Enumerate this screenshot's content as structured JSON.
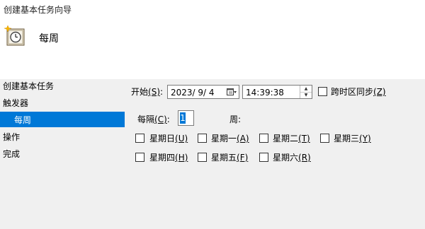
{
  "window": {
    "title": "创建基本任务向导"
  },
  "header": {
    "title": "每周",
    "icon": "task-clock-icon"
  },
  "steps": {
    "items": [
      {
        "label": "创建基本任务"
      },
      {
        "label": "触发器"
      },
      {
        "label": "每周",
        "active": true
      },
      {
        "label": "操作"
      },
      {
        "label": "完成"
      }
    ]
  },
  "form": {
    "start_label": "开始",
    "start_key": "(S)",
    "date_value": "2023/ 9/ 4",
    "time_value": "14:39:38",
    "sync_label": "跨时区同步",
    "sync_key": "(Z)",
    "sync_checked": false,
    "every_label": "每隔",
    "every_key": "(C)",
    "every_value": "1",
    "week_suffix": "周:",
    "days": [
      {
        "label": "星期日",
        "key": "(U)",
        "checked": false
      },
      {
        "label": "星期一",
        "key": "(A)",
        "checked": false
      },
      {
        "label": "星期二",
        "key": "(T)",
        "checked": false
      },
      {
        "label": "星期三",
        "key": "(Y)",
        "checked": false
      },
      {
        "label": "星期四",
        "key": "(H)",
        "checked": false
      },
      {
        "label": "星期五",
        "key": "(F)",
        "checked": false
      },
      {
        "label": "星期六",
        "key": "(R)",
        "checked": false
      }
    ]
  },
  "colors": {
    "selection": "#0078d7",
    "panel": "#f0f0f0"
  }
}
